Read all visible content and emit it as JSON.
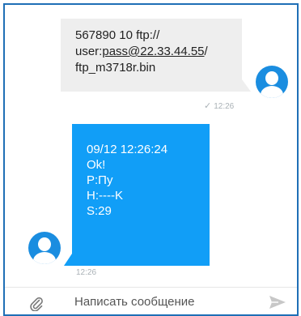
{
  "outgoing": {
    "lines": [
      "567890 10 ftp://",
      "user:pass@22.33.44.55/",
      "ftp_m3718r.bin"
    ],
    "link_part1": "pass@22.33.44.55",
    "status_check": "✓",
    "time": "12:26"
  },
  "incoming": {
    "lines": [
      "09/12 12:26:24",
      "Ok!",
      "P:Пу",
      "H:----K",
      "S:29"
    ],
    "time": "12:26"
  },
  "composer": {
    "placeholder": "Написать сообщение"
  },
  "colors": {
    "incoming_bubble": "#119ef7",
    "outgoing_bubble": "#eeeeee",
    "avatar": "#1a8de0",
    "frame_border": "#1f6fb6"
  },
  "icons": {
    "attach": "paperclip-icon",
    "send": "send-icon",
    "avatar": "person-icon"
  }
}
